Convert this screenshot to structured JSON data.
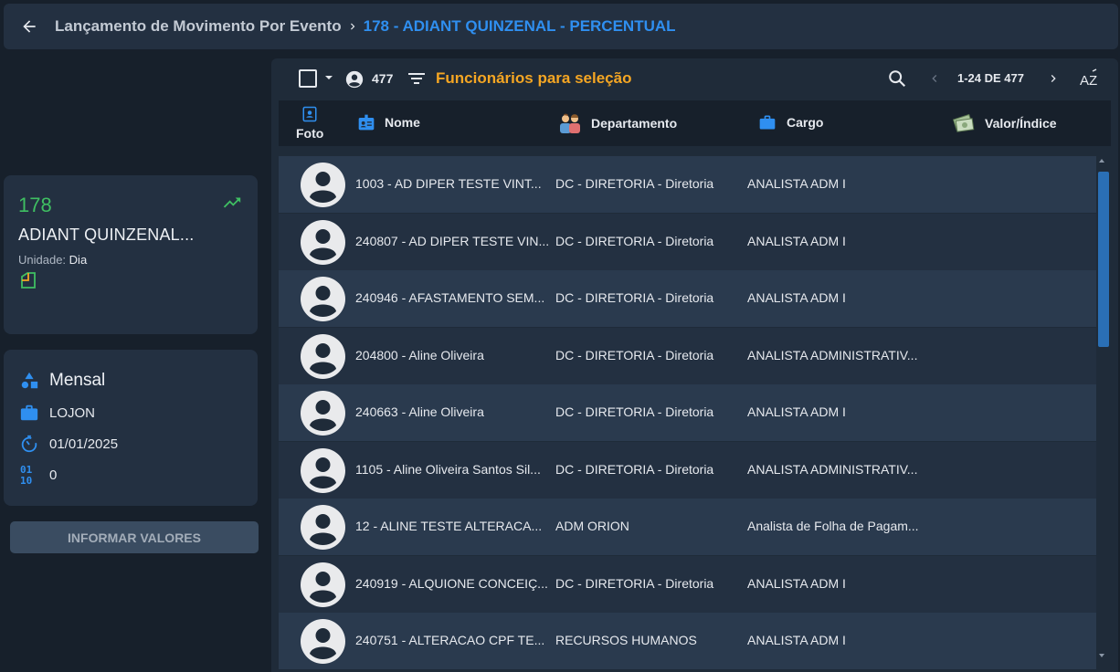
{
  "header": {
    "breadcrumb_parent": "Lançamento de Movimento Por Evento",
    "breadcrumb_current": "178 - ADIANT QUINZENAL - PERCENTUAL"
  },
  "event_card": {
    "code": "178",
    "name": "ADIANT QUINZENAL...",
    "unit_label": "Unidade:",
    "unit_value": "Dia"
  },
  "info_card": {
    "period": "Mensal",
    "company": "LOJON",
    "date": "01/01/2025",
    "value": "0"
  },
  "inform_button_label": "INFORMAR VALORES",
  "toolbar": {
    "employee_count": "477",
    "title": "Funcionários para seleção",
    "page_info": "1-24 DE 477"
  },
  "columns": {
    "foto": "Foto",
    "nome": "Nome",
    "departamento": "Departamento",
    "cargo": "Cargo",
    "valor": "Valor/Índice"
  },
  "rows": [
    {
      "nome": "1003 - AD DIPER TESTE VINT...",
      "departamento": "DC - DIRETORIA - Diretoria",
      "cargo": "ANALISTA ADM I"
    },
    {
      "nome": "240807 - AD DIPER TESTE VIN...",
      "departamento": "DC - DIRETORIA - Diretoria",
      "cargo": "ANALISTA ADM I"
    },
    {
      "nome": "240946 - AFASTAMENTO SEM...",
      "departamento": "DC - DIRETORIA - Diretoria",
      "cargo": "ANALISTA ADM I"
    },
    {
      "nome": "204800 - Aline Oliveira",
      "departamento": "DC - DIRETORIA - Diretoria",
      "cargo": "ANALISTA ADMINISTRATIV..."
    },
    {
      "nome": "240663 - Aline Oliveira",
      "departamento": "DC - DIRETORIA - Diretoria",
      "cargo": "ANALISTA ADM I"
    },
    {
      "nome": "1105 - Aline Oliveira Santos Sil...",
      "departamento": "DC - DIRETORIA - Diretoria",
      "cargo": "ANALISTA ADMINISTRATIV..."
    },
    {
      "nome": "12 - ALINE TESTE ALTERACA...",
      "departamento": "ADM ORION",
      "cargo": "Analista de Folha de Pagam..."
    },
    {
      "nome": "240919 - ALQUIONE CONCEIÇ...",
      "departamento": "DC - DIRETORIA - Diretoria",
      "cargo": "ANALISTA ADM I"
    },
    {
      "nome": "240751 - ALTERACAO CPF TE...",
      "departamento": "RECURSOS HUMANOS",
      "cargo": "ANALISTA ADM I"
    }
  ]
}
